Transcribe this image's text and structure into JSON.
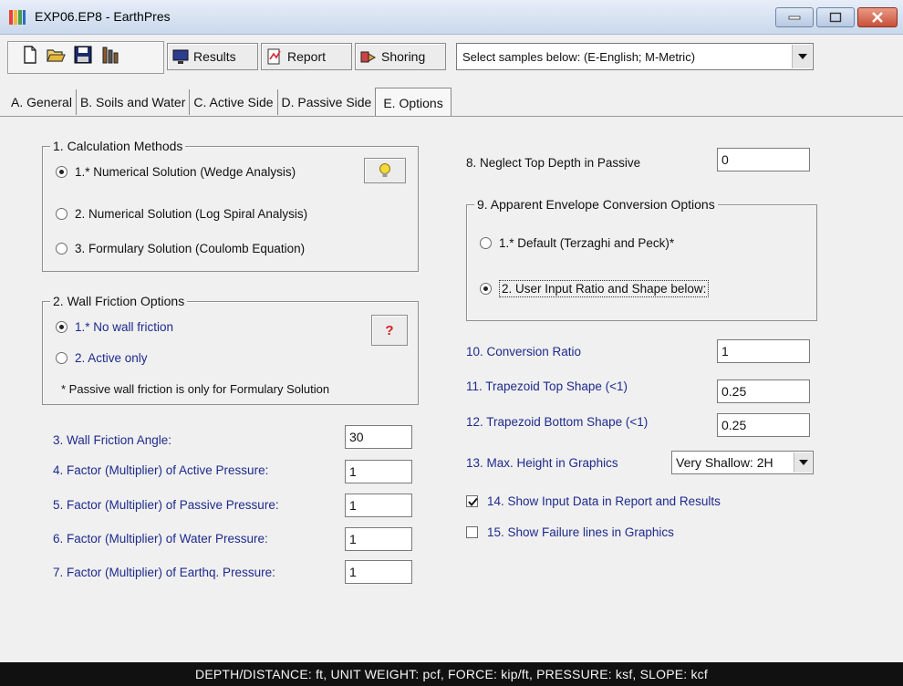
{
  "window": {
    "title": "EXP06.EP8 - EarthPres",
    "icon_colors": [
      "#e8423a",
      "#f3b63c",
      "#4aa04a",
      "#2e6cc5"
    ]
  },
  "toolbar": {
    "new_icon": "new-file-icon",
    "open_icon": "open-folder-icon",
    "save_icon": "save-disk-icon",
    "wall_icon": "wall-icon",
    "results_label": "Results",
    "report_label": "Report",
    "shoring_label": "Shoring",
    "samples_select_value": "Select samples below:  (E-English; M-Metric)"
  },
  "tabs": [
    {
      "label": "A. General"
    },
    {
      "label": "B. Soils and Water"
    },
    {
      "label": "C. Active Side"
    },
    {
      "label": "D. Passive Side"
    },
    {
      "label": "E. Options"
    }
  ],
  "calc_methods": {
    "title": "1. Calculation Methods",
    "options": [
      {
        "label": "1.* Numerical Solution (Wedge Analysis)",
        "selected": true
      },
      {
        "label": "2. Numerical Solution (Log Spiral Analysis)",
        "selected": false
      },
      {
        "label": "3. Formulary Solution (Coulomb Equation)",
        "selected": false
      }
    ],
    "hint_icon": "lightbulb-icon"
  },
  "wall_friction": {
    "title": "2. Wall Friction Options",
    "options": [
      {
        "label": "1.* No wall friction",
        "selected": true
      },
      {
        "label": "2. Active only",
        "selected": false
      }
    ],
    "help_label": "?",
    "note": "* Passive wall friction is only for Formulary Solution"
  },
  "factors": [
    {
      "label": "3. Wall Friction Angle:",
      "value": "30"
    },
    {
      "label": "4. Factor (Multiplier) of Active Pressure:",
      "value": "1"
    },
    {
      "label": "5. Factor (Multiplier) of Passive Pressure:",
      "value": "1"
    },
    {
      "label": "6. Factor (Multiplier) of Water Pressure:",
      "value": "1"
    },
    {
      "label": "7. Factor (Multiplier) of Earthq. Pressure:",
      "value": "1"
    }
  ],
  "neglect_top": {
    "label": "8. Neglect Top Depth in Passive",
    "value": "0"
  },
  "envelope": {
    "title": "9. Apparent Envelope Conversion Options",
    "options": [
      {
        "label": "1.* Default (Terzaghi and Peck)*",
        "selected": false
      },
      {
        "label": "2. User Input Ratio and Shape below:",
        "selected": true
      }
    ]
  },
  "right_fields": [
    {
      "label": "10. Conversion Ratio",
      "value": "1"
    },
    {
      "label": "11. Trapezoid Top Shape  (<1)",
      "value": "0.25"
    },
    {
      "label": "12. Trapezoid Bottom Shape (<1)",
      "value": "0.25"
    }
  ],
  "max_height": {
    "label": "13. Max. Height in Graphics",
    "value": "Very Shallow: 2H"
  },
  "checks": [
    {
      "label": "14. Show Input Data in Report and Results",
      "checked": true
    },
    {
      "label": "15. Show Failure lines in Graphics",
      "checked": false
    }
  ],
  "status": "DEPTH/DISTANCE: ft, UNIT WEIGHT: pcf, FORCE: kip/ft, PRESSURE: ksf, SLOPE: kcf",
  "colors": {
    "label_blue": "#1e2a8c",
    "status_bg": "#111111"
  }
}
